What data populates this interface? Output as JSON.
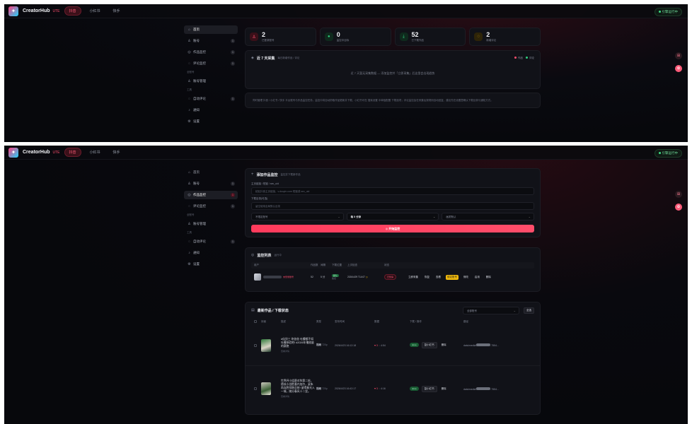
{
  "brand": {
    "name": "CreatorHub",
    "tag": "UTE"
  },
  "platforms": [
    "抖音",
    "小红书",
    "快手"
  ],
  "status": "引擎运行中",
  "sidebar": {
    "items": [
      {
        "icon": "home",
        "label": "首页",
        "badge": ""
      },
      {
        "icon": "user",
        "label": "账号",
        "badge": "1"
      },
      {
        "icon": "monitor",
        "label": "作品监控",
        "badge": "1"
      },
      {
        "icon": "comment",
        "label": "评论监控",
        "badge": "1"
      }
    ],
    "section_account": "全账号",
    "account_item": "账号管理",
    "section_tools": "工具",
    "tools": [
      {
        "label": "自动评论",
        "badge": "1"
      },
      {
        "label": "通知",
        "badge": ""
      },
      {
        "label": "设置",
        "badge": ""
      }
    ]
  },
  "dashboard": {
    "stats": [
      {
        "value": "2",
        "label": "已登录账号",
        "color": "#ff4d6d"
      },
      {
        "value": "0",
        "label": "监控中目标",
        "color": "#2fd07f"
      },
      {
        "value": "52",
        "label": "已下载作品",
        "color": "#2fd07f"
      },
      {
        "value": "2",
        "label": "新增评论",
        "color": "#f0b90b"
      }
    ],
    "trend_title": "近 7 天采集",
    "trend_sub": "每日新增作品 / 评论",
    "legend": [
      "作品",
      "评论"
    ],
    "empty": "近 7 天暂无采集数据 — 添加监控并「立即采集」后这里会出现趋势",
    "note": "同时管理 抖音 / 小红书 / 快手 平台账号与作品监控任务。监控中将自动抓取作品更新并下载，小红书可在 搜索设置 中单独配置 下载选项；评论监控会在采集后按规则自动回复，建议先在设置里确认下载目录与通知方式。"
  },
  "monitor_form": {
    "title": "添加作品监控",
    "sub": "监控并下载新作品",
    "url_label": "主页链接 / 短链 / sec_uid",
    "url_placeholder": "粘贴抖音主页链接、v.douyin.com 短链或 sec_uid",
    "dir_label": "下载目录(可选)",
    "dir_placeholder": "留空使用全局默认目录",
    "selects": [
      "不限定账号",
      "每 5 分钟",
      "画质默认"
    ],
    "submit": "开始监控"
  },
  "monitor_list": {
    "title": "监控列表",
    "sub": "运行中",
    "headers": [
      "用户",
      "作品数",
      "间隔",
      "下载位置",
      "上次检查",
      "状态"
    ],
    "row": {
      "nickname_note": "未登录账号",
      "works": "52",
      "interval": "5 分",
      "download_tag": "默认",
      "download_sub": "路径",
      "last_check": "2026/4/29 T14:07",
      "status": "已暂停",
      "actions": [
        "立即采集",
        "恢复",
        "查看",
        "绑定账号",
        "修改",
        "启用",
        "删除"
      ]
    }
  },
  "works": {
    "title": "最新作品 / 下载状态",
    "filter": "全部账号",
    "filter_btn": "全选",
    "headers": [
      "封面",
      "描述",
      "类型",
      "发布时间",
      "数据",
      "下载 / 操作",
      "路径"
    ],
    "rows": [
      {
        "desc": "#仙剑三 你爸爸 吐槽都不如吐槽体验吧! #2026年播放量的赛跑",
        "sub": "查看详情",
        "type": "视频",
        "quality": "720p",
        "published": "2026/4/23 16:12:18",
        "likes": "♥ 3",
        "comments": "◌ 4:54",
        "status": "done",
        "actions": [
          "复小红书",
          "删除"
        ],
        "path": "data\\media\\",
        "path_suffix": ".7554…"
      },
      {
        "desc": "世界杯小组赛对阵第二轮，德成小战胜墨内加尔，梁朱再连胜领跑总统! 留得春光入一城，随分春风十二里。",
        "sub": "查看详情",
        "type": "视频",
        "quality": "720p",
        "published": "2026/4/23 16:42:17",
        "likes": "♥ 3",
        "comments": "◌ 4:16",
        "status": "done",
        "actions": [
          "复小红书",
          "删除"
        ],
        "path": "data\\media\\",
        "path_suffix": ".7554…"
      }
    ]
  }
}
